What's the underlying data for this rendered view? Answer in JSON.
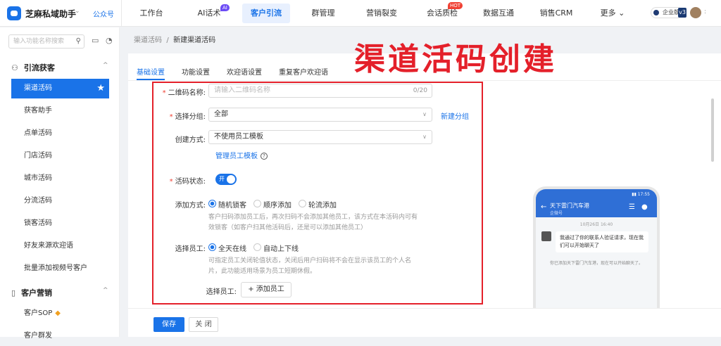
{
  "app": {
    "name": "芝麻私域助手",
    "caret": "⌄",
    "gzh": "公众号"
  },
  "topnav": [
    {
      "label": "工作台"
    },
    {
      "label": "AI话术",
      "badge": "AI"
    },
    {
      "label": "客户引流",
      "active": true
    },
    {
      "label": "群管理"
    },
    {
      "label": "营销裂变"
    },
    {
      "label": "会话质检",
      "badge": "HOT"
    },
    {
      "label": "数据互通"
    },
    {
      "label": "销售CRM"
    },
    {
      "label": "更多 ⌄"
    }
  ],
  "account": {
    "enterprise": "企业版",
    "version": "v3",
    "caret": ":"
  },
  "sidebar": {
    "search_placeholder": "输入功能名称搜索",
    "section1": {
      "title": "引流获客",
      "arrow": "^"
    },
    "section2": {
      "title": "客户营销",
      "arrow": "^"
    },
    "items1": [
      "渠道活码",
      "获客助手",
      "点单活码",
      "门店活码",
      "城市活码",
      "分流活码",
      "锁客活码",
      "好友来源欢迎语",
      "批量添加视频号客户"
    ],
    "items2": [
      "客户SOP",
      "客户群发"
    ]
  },
  "breadcrumb": {
    "parent": "渠道活码",
    "sep": "/",
    "current": "新建渠道活码"
  },
  "overlay_title": "渠道活码创建",
  "tabs": [
    "基础设置",
    "功能设置",
    "欢迎语设置",
    "重复客户欢迎语"
  ],
  "form": {
    "name": {
      "label": "二维码名称:",
      "placeholder": "请输入二维码名称",
      "count": "0/20"
    },
    "group": {
      "label": "选择分组:",
      "value": "全部",
      "link": "新建分组"
    },
    "method": {
      "label": "创建方式:",
      "value": "不使用员工模板",
      "link": "管理员工模板",
      "help": "?"
    },
    "status": {
      "label": "活码状态:",
      "toggle": "开"
    },
    "add_mode": {
      "label": "添加方式:",
      "options": [
        "随机锁客",
        "顺序添加",
        "轮流添加"
      ],
      "hint": "客户扫码添加员工后，再次扫码不会添加其他员工，该方式在本活码内可有效锁客（如客户扫其他活码后，还是可以添加其他员工）"
    },
    "staff_mode": {
      "label": "选择员工:",
      "options": [
        "全天在线",
        "自动上下线"
      ],
      "hint": "可指定员工关闭轮值状态，关闭后用户扫码将不会在显示该员工的个人名片，此功能适用场景为员工短期休假。"
    },
    "staff_select": {
      "label": "选择员工:",
      "button": "+ 添加员工"
    }
  },
  "footer": {
    "save": "保存",
    "close": "关 闭"
  },
  "phone": {
    "status": "▮▮ 17:55",
    "back": "←",
    "name": "天下雷门汽车港",
    "sub": "企微号",
    "time": "10月26日 16:40",
    "message": "我通过了你的联系人验证请求，现在我们可以开始聊天了",
    "note": "你已添加天下雷门汽车港，现在可以开始聊天了。"
  }
}
